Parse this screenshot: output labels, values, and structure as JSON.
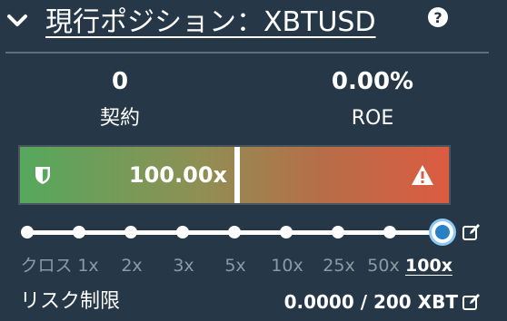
{
  "header": {
    "title": "現行ポジション：XBTUSD",
    "collapse_icon": "chevron-down-icon",
    "help_icon": "question-circle-icon"
  },
  "stats": {
    "quantity": {
      "value": "0",
      "label": "契約"
    },
    "roe": {
      "value": "0.00%",
      "label": "ROE"
    }
  },
  "liquidation_bar": {
    "value": "100.00x",
    "left_icon": "shield-icon",
    "right_icon": "warning-icon",
    "colors": {
      "start": "#55a85c",
      "end": "#dc5b41",
      "marker": "#ffffff"
    }
  },
  "leverage": {
    "options": [
      "クロス",
      "1x",
      "2x",
      "3x",
      "5x",
      "10x",
      "25x",
      "50x",
      "100x"
    ],
    "selected": "100x",
    "edit_icon": "edit-icon",
    "accent": "#2a7fc6"
  },
  "risk_limit": {
    "label": "リスク制限",
    "value": "0.0000 / 200 XBT",
    "edit_icon": "edit-icon"
  },
  "colors": {
    "background": "#263847",
    "muted_text": "#8b9aa6",
    "divider": "#5d6f7c"
  }
}
